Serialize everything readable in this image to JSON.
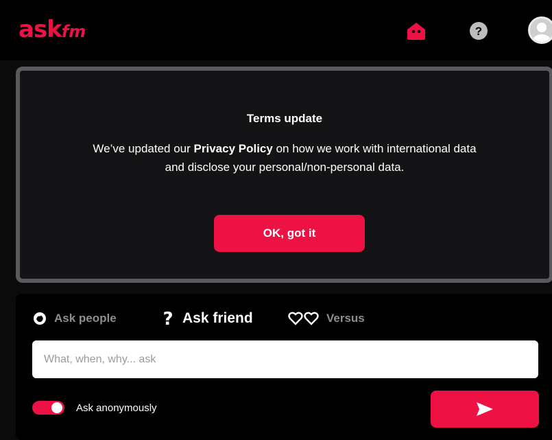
{
  "header": {
    "logo_main": "ask",
    "logo_sub": "fm",
    "icons": [
      "home-icon",
      "help-icon",
      "avatar-icon"
    ]
  },
  "terms": {
    "title": "Terms update",
    "body_prefix": "We’ve updated our ",
    "body_link": "Privacy Policy",
    "body_suffix": " on how we work with international data and disclose your personal/non-personal data.",
    "button_label": "OK, got it"
  },
  "ask": {
    "tabs": [
      {
        "label": "Ask people",
        "icon": "waving-hand-icon",
        "active": false
      },
      {
        "label": "Ask friend",
        "icon": "question-mark-icon",
        "active": true
      },
      {
        "label": "Versus",
        "icon": "two-hearts-icon",
        "active": false
      }
    ],
    "input_placeholder": "What, when, why... ask",
    "anonymous_label": "Ask anonymously",
    "anonymous_enabled": true,
    "send_icon": "send-icon"
  },
  "colors": {
    "accent": "#ee1144",
    "background": "#0b0b0c",
    "card": "#141416",
    "card_border": "#5a5a5e",
    "muted_text": "#8d8d92"
  }
}
